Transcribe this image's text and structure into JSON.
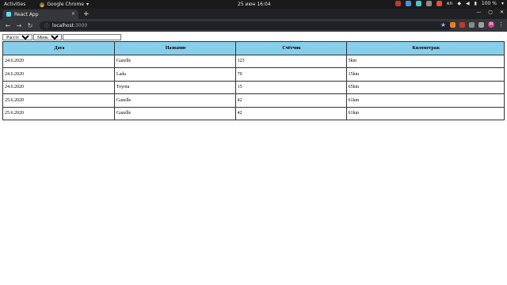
{
  "system_bar": {
    "activities": "Activities",
    "app_name": "Google Chrome",
    "clock": "25 июн  16:04",
    "lang": "en",
    "battery": "100 %",
    "tray_icons": [
      "tray-app-red",
      "tray-app-blue",
      "tray-app-cyan",
      "tray-app-grey",
      "tray-app-red-2"
    ]
  },
  "browser": {
    "tab_title": "React App",
    "url_host": "localhost",
    "url_port": ":3000",
    "avatar_letter": "M"
  },
  "filters": {
    "column_select": "Расстояние",
    "compare_select": "Меньше",
    "value": ""
  },
  "table": {
    "headers": [
      "Дата",
      "Название",
      "Счётчик",
      "Километраж"
    ],
    "rows": [
      [
        "24.6.2020",
        "Gazelle",
        "123",
        "5km"
      ],
      [
        "24.6.2020",
        "Lada",
        "70",
        "15km"
      ],
      [
        "24.6.2020",
        "Toyota",
        "15",
        "65km"
      ],
      [
        "25.6.2020",
        "Gazelle",
        "42",
        "61km"
      ],
      [
        "25.6.2020",
        "Gazelle",
        "42",
        "61km"
      ]
    ]
  }
}
